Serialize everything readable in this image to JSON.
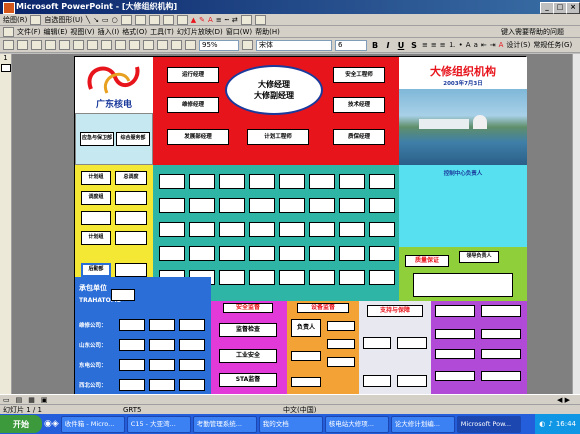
{
  "window": {
    "title": "Microsoft PowerPoint - [大修组织机构]"
  },
  "toolbar1": {
    "draw": "绘图(R)",
    "autoshape": "自选图形(U)"
  },
  "menu": [
    "文件(F)",
    "编辑(E)",
    "视图(V)",
    "插入(I)",
    "格式(O)",
    "工具(T)",
    "幻灯片放映(D)",
    "窗口(W)",
    "帮助(H)"
  ],
  "menu_right": "键入需要帮助的问题",
  "toolbar3": {
    "zoom": "95%",
    "font": "宋体",
    "size": "6",
    "design": "设计(S)",
    "tasks": "常规任务(G)"
  },
  "outline": {
    "slide_num": "1"
  },
  "slide": {
    "logo_text": "广东核电",
    "title": "大修组织机构",
    "date": "2003年7月3日",
    "center": {
      "line1": "大修经理",
      "line2": "大修副经理"
    },
    "top_roles": [
      "运行经理",
      "安全工程师",
      "维修经理",
      "技术经理",
      "发展部经理",
      "计划工程师",
      "质保经理"
    ],
    "mid_left_labels": [
      "应急与保卫部",
      "综合服务部"
    ],
    "ctrl_label": "控制中心负责人",
    "left_col": [
      {
        "a": "计划组",
        "b": "总调度"
      },
      {
        "a": "调度组",
        "b": ""
      },
      {
        "a": "",
        "b": ""
      },
      {
        "a": "计划组",
        "b": ""
      },
      {
        "a": "后勤部",
        "b": ""
      }
    ],
    "teal_rows": [
      [
        "",
        "",
        "",
        "",
        "",
        "",
        "",
        ""
      ],
      [
        "",
        "",
        "",
        "",
        "",
        "",
        "",
        ""
      ],
      [
        "",
        "",
        "",
        "",
        "",
        "",
        "",
        ""
      ],
      [
        "",
        "",
        "",
        "",
        "",
        "",
        "",
        ""
      ],
      [
        "",
        "",
        "",
        "",
        "",
        "",
        "",
        ""
      ]
    ],
    "quality": {
      "label": "质量保证",
      "lead": "领导负责人"
    },
    "contractor": {
      "title": "承包单位",
      "name": "TRAHATOME"
    },
    "contractor_rows": [
      "维修公司：",
      "山东公司：",
      "东电公司：",
      "西北公司："
    ],
    "safety": {
      "title": "安全监督",
      "items": [
        "监督检查",
        "工业安全",
        "STA监督"
      ]
    },
    "equipment": {
      "title": "设备监督",
      "lead": "负责人",
      "items": [
        "",
        "",
        "",
        "",
        ""
      ]
    },
    "support": {
      "title": "支持与保障",
      "items": [
        "",
        "",
        "",
        ""
      ]
    },
    "extra": {
      "title": "",
      "lead": "",
      "items": [
        "",
        "",
        "",
        "",
        "",
        ""
      ]
    }
  },
  "drawbar": {
    "draw": "绘图(R)",
    "autoshape": "自选图形(U)"
  },
  "status": {
    "page": "幻灯片 1 / 1",
    "design": "GRT5",
    "lang": "中文(中国)"
  },
  "taskbar": {
    "start": "开始",
    "tasks": [
      "收件箱 - Micro...",
      "C15 - 大亚湾...",
      "考勤管理系统...",
      "我的文档",
      "核电站大修项...",
      "论大修计划编...",
      "Microsoft Pow..."
    ],
    "clock": "16:44"
  },
  "colors": {
    "red": "#e8141c",
    "teal": "#2fb5a6",
    "cyan": "#56e0f0",
    "yellow": "#f4e834",
    "blue": "#2b6ed8",
    "green": "#8fcf3a",
    "magenta": "#e23ad8",
    "orange": "#f3a236",
    "purple": "#b14ad6"
  }
}
